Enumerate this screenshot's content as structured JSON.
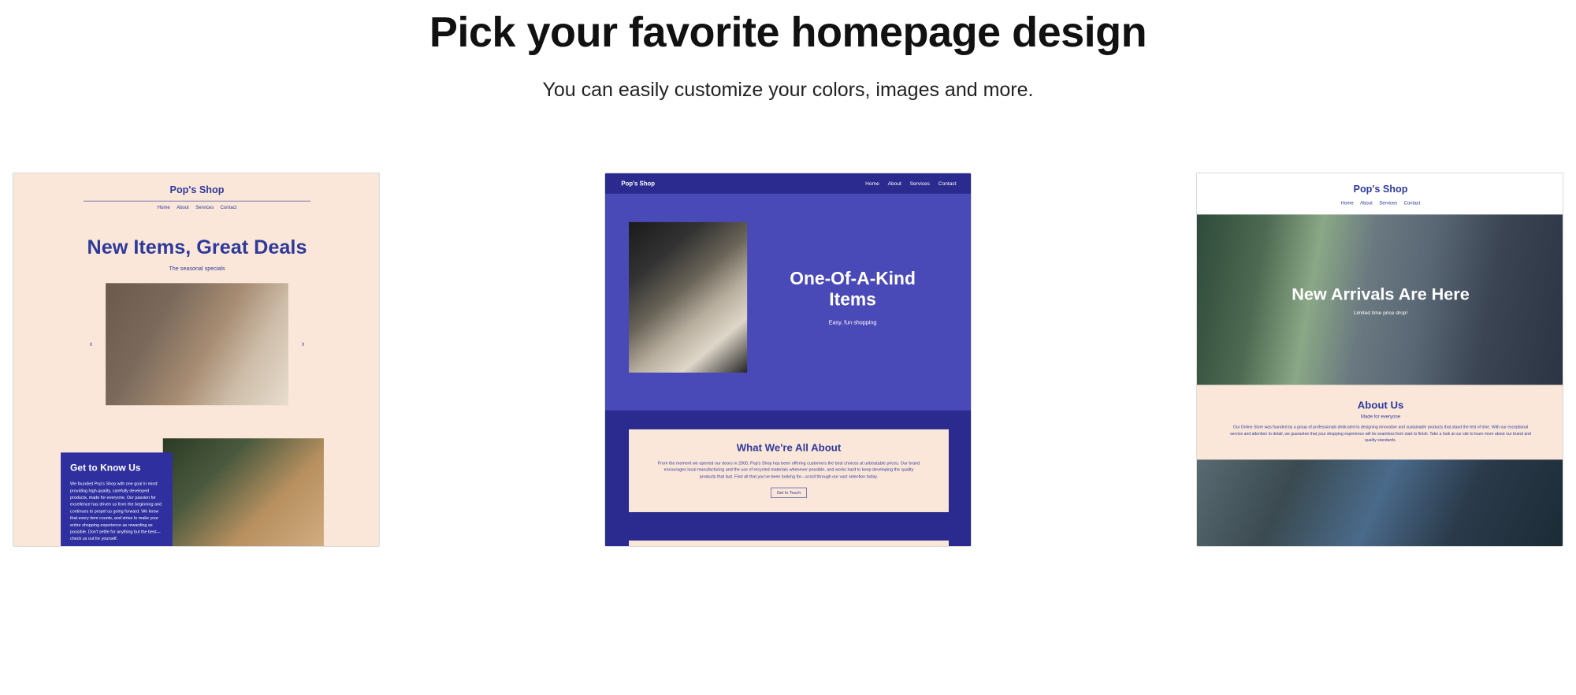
{
  "header": {
    "title": "Pick your favorite homepage design",
    "subtitle": "You can easily customize your colors, images and more."
  },
  "common_nav": {
    "home": "Home",
    "about": "About",
    "services": "Services",
    "contact": "Contact"
  },
  "template1": {
    "site_title": "Pop's Shop",
    "hero_title": "New Items, Great Deals",
    "hero_sub": "The seasonal specials",
    "arrow_left": "‹",
    "arrow_right": "›",
    "know_title": "Get to Know Us",
    "know_body": "We founded Pop's Shop with one goal in mind: providing high-quality, carefully developed products, made for everyone. Our passion for excellence has driven us from the beginning and continues to propel us going forward. We know that every item counts, and strive to make your entire shopping experience as rewarding as possible. Don't settle for anything but the best—check us out for yourself."
  },
  "template2": {
    "site_title": "Pop's Shop",
    "hero_title": "One-Of-A-Kind Items",
    "hero_sub": "Easy, fun shopping",
    "about_title": "What We're All About",
    "about_body": "From the moment we opened our doors in 2000, Pop's Shop has been offering customers the best choices at unbeatable prices. Our brand encourages local manufacturing and the use of recycled materials whenever possible, and works hard to keep developing the quality products that last. Find all that you've been looking for—scroll through our vast selection today.",
    "cta": "Get In Touch"
  },
  "template3": {
    "site_title": "Pop's Shop",
    "hero_title": "New Arrivals Are Here",
    "hero_sub": "Limited time price drop!",
    "about_title": "About Us",
    "about_sub": "Made for everyone",
    "about_body": "Our Online Store was founded by a group of professionals dedicated to designing innovative and sustainable products that stand the test of time. With our exceptional service and attention to detail, we guarantee that your shopping experience will be seamless from start to finish. Take a look at our site to learn more about our brand and quality standards."
  }
}
